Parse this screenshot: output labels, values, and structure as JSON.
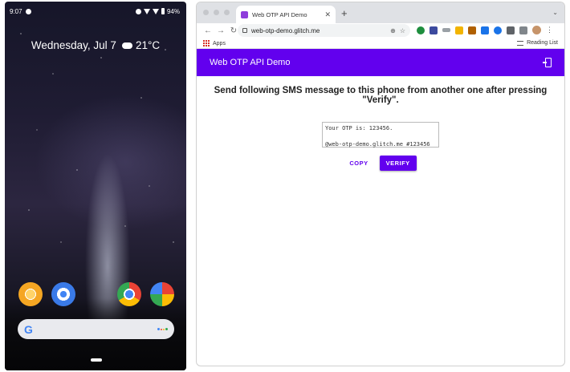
{
  "phone": {
    "status_bar": {
      "time": "9:07",
      "battery": "94%"
    },
    "date_widget": {
      "date": "Wednesday, Jul 7",
      "temperature": "21°C"
    },
    "dock_apps": [
      "chromebook-app-icon",
      "settings-icon",
      "chrome-icon",
      "photos-icon"
    ],
    "google_bar": {
      "logo": "G"
    }
  },
  "browser": {
    "tab": {
      "title": "Web OTP API Demo"
    },
    "new_tab": "+",
    "address_bar": {
      "url": "web-otp-demo.glitch.me"
    },
    "bookmarks": {
      "apps_label": "Apps",
      "reading_list_label": "Reading List"
    },
    "colors": {
      "app_bar": "#6200ee"
    }
  },
  "page": {
    "app_bar_title": "Web OTP API Demo",
    "instruction": "Send following SMS message to this phone from another one after pressing \"Verify\".",
    "sms_line_1": "Your OTP is: 123456.",
    "sms_line_2": "@web-otp-demo.glitch.me #123456",
    "copy_label": "COPY",
    "verify_label": "VERIFY"
  }
}
